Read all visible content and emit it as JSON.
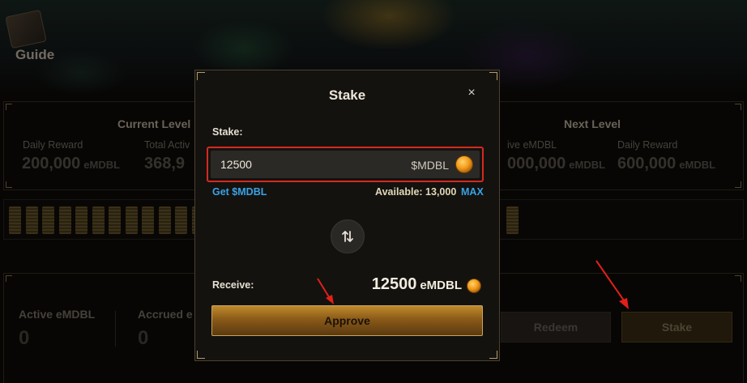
{
  "background": {
    "guide_label": "Guide",
    "current_level": {
      "title": "Current Level",
      "daily_reward_label": "Daily Reward",
      "daily_reward_value": "200,000",
      "daily_reward_unit": "eMDBL",
      "total_active_label": "Total Activ",
      "total_active_value": "368,9"
    },
    "next_level": {
      "title": "Next Level",
      "active_label": "ive eMDBL",
      "active_value": "000,000",
      "active_unit": "eMDBL",
      "daily_reward_label": "Daily Reward",
      "daily_reward_value": "600,000",
      "daily_reward_unit": "eMDBL"
    },
    "stats": {
      "active_label": "Active eMDBL",
      "active_value": "0",
      "accrued_label": "Accrued e",
      "accrued_value": "0"
    },
    "redeem_label": "Redeem",
    "stake_label": "Stake"
  },
  "modal": {
    "title": "Stake",
    "close_glyph": "×",
    "stake_field_label": "Stake:",
    "input_value": "12500",
    "token": "$MDBL",
    "get_link": "Get $MDBL",
    "available_label": "Available: 13,000",
    "max_label": "MAX",
    "receive_label": "Receive:",
    "receive_value": "12500",
    "receive_unit": "eMDBL",
    "approve_label": "Approve"
  },
  "icons": {
    "coin": "coin-icon",
    "swap": "swap-arrows-icon",
    "close": "close-icon"
  },
  "colors": {
    "highlight_border": "#d42a1f",
    "link_blue": "#3aa2e6",
    "gold_button": "#c08a2d"
  }
}
